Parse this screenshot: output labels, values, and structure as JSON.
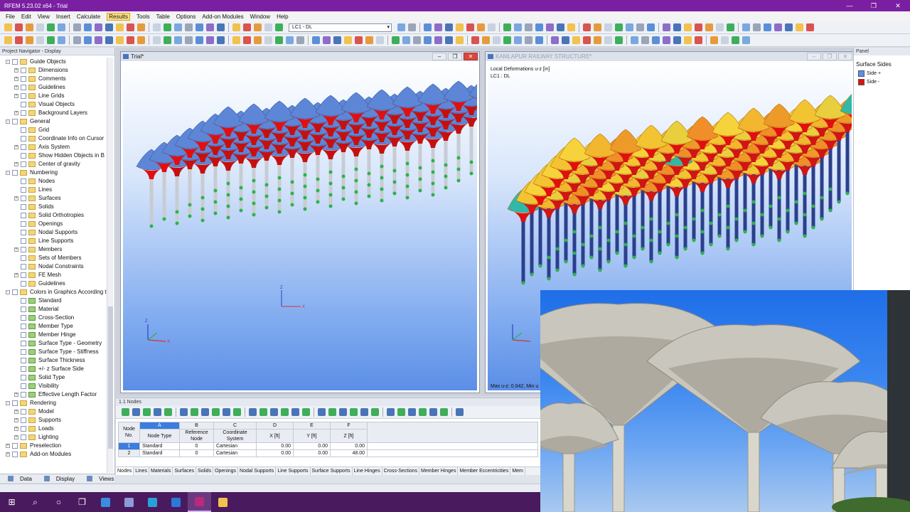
{
  "titlebar": {
    "title": "RFEM 5.23.02 x64 - Trial",
    "minimize": "—",
    "maximize": "❐",
    "close": "✕"
  },
  "menu": [
    "File",
    "Edit",
    "View",
    "Insert",
    "Calculate",
    "Results",
    "Tools",
    "Table",
    "Options",
    "Add-on Modules",
    "Window",
    "Help"
  ],
  "menu_active": "Results",
  "toolbar": {
    "load_case": "LC1 - DL"
  },
  "navigator": {
    "title": "Project Navigator - Display",
    "items": [
      {
        "label": "Guide Objects",
        "level": 1,
        "expand": "-",
        "checked": false
      },
      {
        "label": "Dimensions",
        "level": 2,
        "expand": "+",
        "checked": false
      },
      {
        "label": "Comments",
        "level": 2,
        "expand": "+",
        "checked": false
      },
      {
        "label": "Guidelines",
        "level": 2,
        "expand": "+",
        "checked": false
      },
      {
        "label": "Line Grids",
        "level": 2,
        "expand": "+",
        "checked": false
      },
      {
        "label": "Visual Objects",
        "level": 2,
        "expand": "",
        "checked": false
      },
      {
        "label": "Background Layers",
        "level": 2,
        "expand": "+",
        "checked": false
      },
      {
        "label": "General",
        "level": 1,
        "expand": "-",
        "checked": false
      },
      {
        "label": "Grid",
        "level": 2,
        "expand": "",
        "checked": false
      },
      {
        "label": "Coordinate Info on Cursor",
        "level": 2,
        "expand": "",
        "checked": false
      },
      {
        "label": "Axis System",
        "level": 2,
        "expand": "+",
        "checked": false
      },
      {
        "label": "Show Hidden Objects in B",
        "level": 2,
        "expand": "",
        "checked": false
      },
      {
        "label": "Center of gravity",
        "level": 2,
        "expand": "+",
        "checked": false
      },
      {
        "label": "Numbering",
        "level": 1,
        "expand": "-",
        "checked": false
      },
      {
        "label": "Nodes",
        "level": 2,
        "expand": "",
        "checked": false
      },
      {
        "label": "Lines",
        "level": 2,
        "expand": "",
        "checked": false
      },
      {
        "label": "Surfaces",
        "level": 2,
        "expand": "+",
        "checked": false
      },
      {
        "label": "Solids",
        "level": 2,
        "expand": "",
        "checked": false
      },
      {
        "label": "Solid Orthotropies",
        "level": 2,
        "expand": "",
        "checked": false
      },
      {
        "label": "Openings",
        "level": 2,
        "expand": "",
        "checked": false
      },
      {
        "label": "Nodal Supports",
        "level": 2,
        "expand": "",
        "checked": false
      },
      {
        "label": "Line Supports",
        "level": 2,
        "expand": "",
        "checked": false
      },
      {
        "label": "Members",
        "level": 2,
        "expand": "+",
        "checked": false
      },
      {
        "label": "Sets of Members",
        "level": 2,
        "expand": "",
        "checked": false
      },
      {
        "label": "Nodal Constraints",
        "level": 2,
        "expand": "",
        "checked": false
      },
      {
        "label": "FE Mesh",
        "level": 2,
        "expand": "+",
        "checked": false
      },
      {
        "label": "Guidelines",
        "level": 2,
        "expand": "",
        "checked": false
      },
      {
        "label": "Colors in Graphics According t",
        "level": 1,
        "expand": "-",
        "checked": false
      },
      {
        "label": "Standard",
        "level": 2,
        "expand": "",
        "checked": false,
        "green": true
      },
      {
        "label": "Material",
        "level": 2,
        "expand": "",
        "checked": false,
        "green": true
      },
      {
        "label": "Cross-Section",
        "level": 2,
        "expand": "",
        "checked": false,
        "green": true
      },
      {
        "label": "Member Type",
        "level": 2,
        "expand": "",
        "checked": false,
        "green": true
      },
      {
        "label": "Member Hinge",
        "level": 2,
        "expand": "",
        "checked": false,
        "green": true
      },
      {
        "label": "Surface Type - Geometry",
        "level": 2,
        "expand": "",
        "checked": false,
        "green": true
      },
      {
        "label": "Surface Type - Stiffness",
        "level": 2,
        "expand": "",
        "checked": false,
        "green": true
      },
      {
        "label": "Surface Thickness",
        "level": 2,
        "expand": "",
        "checked": false,
        "green": true
      },
      {
        "label": "+/- z Surface Side",
        "level": 2,
        "expand": "",
        "checked": false,
        "green": true
      },
      {
        "label": "Solid Type",
        "level": 2,
        "expand": "",
        "checked": false,
        "green": true
      },
      {
        "label": "Visibility",
        "level": 2,
        "expand": "",
        "checked": false,
        "green": true
      },
      {
        "label": "Effective Length Factor",
        "level": 2,
        "expand": "+",
        "checked": false,
        "green": true
      },
      {
        "label": "Rendering",
        "level": 1,
        "expand": "-",
        "checked": false
      },
      {
        "label": "Model",
        "level": 2,
        "expand": "+",
        "checked": false
      },
      {
        "label": "Supports",
        "level": 2,
        "expand": "+",
        "checked": false
      },
      {
        "label": "Loads",
        "level": 2,
        "expand": "+",
        "checked": false
      },
      {
        "label": "Lighting",
        "level": 2,
        "expand": "+",
        "checked": false
      },
      {
        "label": "Preselection",
        "level": 1,
        "expand": "+",
        "checked": false
      },
      {
        "label": "Add-on Modules",
        "level": 1,
        "expand": "+",
        "checked": false
      }
    ],
    "tabs": [
      "Data",
      "Display",
      "Views"
    ]
  },
  "windows": {
    "trial": {
      "title": "Trial*"
    },
    "kamlapur": {
      "title": "KAMLAPUR RAILWAY STRUCTURE*",
      "result_line1": "Local Deformations u-z [in]",
      "result_line2": "LC1 : DL",
      "footer": "Max u-z: 0.042, Min u"
    }
  },
  "panel": {
    "title": "Panel",
    "heading": "Surface Sides",
    "items": [
      {
        "label": "Side +",
        "color": "#5b8ef0"
      },
      {
        "label": "Side -",
        "color": "#e01010"
      }
    ]
  },
  "table": {
    "title": "1.1 Nodes",
    "col_letters": [
      "A",
      "B",
      "C",
      "D",
      "E",
      "F"
    ],
    "group_header": "Node Coordinates",
    "headers": {
      "no": "Node No.",
      "type": "Node Type",
      "ref": "Reference Node",
      "coord": "Coordinate System",
      "x": "X [ft]",
      "y": "Y [ft]",
      "z": "Z [ft]"
    },
    "rows": [
      {
        "no": "1",
        "type": "Standard",
        "ref": "0",
        "coord": "Cartesian",
        "x": "0.00",
        "y": "0.00",
        "z": "0.00"
      },
      {
        "no": "2",
        "type": "Standard",
        "ref": "0",
        "coord": "Cartesian",
        "x": "0.00",
        "y": "0.00",
        "z": "48.00"
      }
    ],
    "tabs": [
      "Nodes",
      "Lines",
      "Materials",
      "Surfaces",
      "Solids",
      "Openings",
      "Nodal Supports",
      "Line Supports",
      "Surface Supports",
      "Line Hinges",
      "Cross-Sections",
      "Member Hinges",
      "Member Eccentricities",
      "Mem"
    ]
  },
  "axis": {
    "z": "Z",
    "x": "X"
  },
  "taskbar": [
    "windows-icon",
    "search-icon",
    "cortana-icon",
    "task-view-icon",
    "store-icon",
    "chat-icon",
    "edge-icon",
    "mail-icon",
    "rfem-icon",
    "explorer-icon"
  ]
}
